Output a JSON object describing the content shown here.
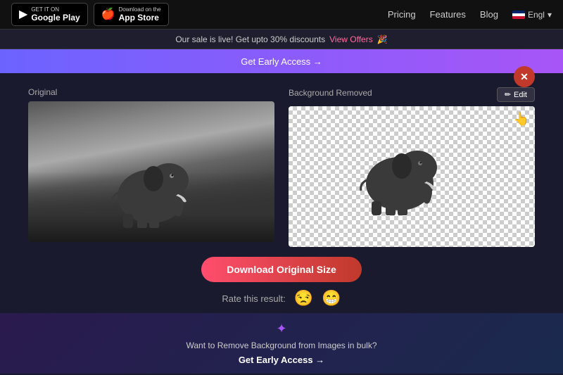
{
  "nav": {
    "google_play_top": "GET IT ON",
    "google_play_main": "Google Play",
    "app_store_top": "Download on the",
    "app_store_main": "App Store",
    "links": [
      "Pricing",
      "Features",
      "Blog"
    ],
    "lang": "Engl"
  },
  "sale_banner": {
    "text": "Our sale is live! Get upto 30% discounts",
    "link_text": "View Offers",
    "emoji": "🎉"
  },
  "early_access_top": {
    "label": "Get Early Access →"
  },
  "images": {
    "original_label": "Original",
    "removed_label": "Background Removed",
    "edit_button": "Edit"
  },
  "download": {
    "button_label": "Download Original Size",
    "rate_label": "Rate this result:",
    "sad_emoji": "😒",
    "happy_emoji": "😁"
  },
  "bottom_banner": {
    "text": "Want to Remove Background from Images in bulk?",
    "cta": "Get Early Access →"
  }
}
